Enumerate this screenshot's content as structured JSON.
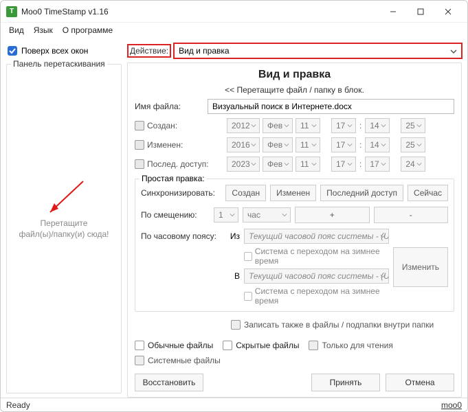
{
  "window": {
    "title": "Moo0 TimeStamp v1.16"
  },
  "menu": {
    "view": "Вид",
    "lang": "Язык",
    "about": "О программе"
  },
  "ontop": {
    "label": "Поверх всех окон"
  },
  "drop": {
    "group": "Панель перетаскивания",
    "line1": "Перетащите",
    "line2": "файл(ы)/папку(и) сюда!"
  },
  "action": {
    "label": "Действие:",
    "value": "Вид и правка"
  },
  "main": {
    "title": "Вид и правка",
    "hint": "<< Перетащите файл / папку в блок.",
    "filename_label": "Имя файла:",
    "filename_value": "Визуальный поиск в Интернете.docx",
    "rows": [
      {
        "label": "Создан:",
        "year": "2012",
        "mon": "Фев",
        "day": "11",
        "h": "17",
        "m": "14",
        "n": "25"
      },
      {
        "label": "Изменен:",
        "year": "2016",
        "mon": "Фев",
        "day": "11",
        "h": "17",
        "m": "14",
        "n": "25"
      },
      {
        "label": "Послед. доступ:",
        "year": "2023",
        "mon": "Фев",
        "day": "11",
        "h": "17",
        "m": "17",
        "n": "24"
      }
    ]
  },
  "edit": {
    "group": "Простая правка:",
    "sync_label": "Синхронизировать:",
    "sync_btns": [
      "Создан",
      "Изменен",
      "Последний доступ",
      "Сейчас"
    ],
    "offset_label": "По смещению:",
    "offset_num": "1",
    "offset_unit": "час",
    "plus": "+",
    "minus": "-",
    "tz_label": "По часовому поясу:",
    "from": "Из",
    "to": "В",
    "tz_value1": "Текущий часовой пояс системы - (U",
    "tz_value2": "Текущий часовой пояс системы - (U",
    "dst": "Система с переходом на зимнее время",
    "change": "Изменить"
  },
  "flags": {
    "subfolders": "Записать также в файлы / подпапки внутри папки",
    "ordinary": "Обычные файлы",
    "hidden": "Скрытые файлы",
    "readonly": "Только для чтения",
    "system": "Системные файлы"
  },
  "buttons": {
    "restore": "Восстановить",
    "apply": "Принять",
    "cancel": "Отмена"
  },
  "status": {
    "ready": "Ready",
    "brand": "moo0"
  }
}
